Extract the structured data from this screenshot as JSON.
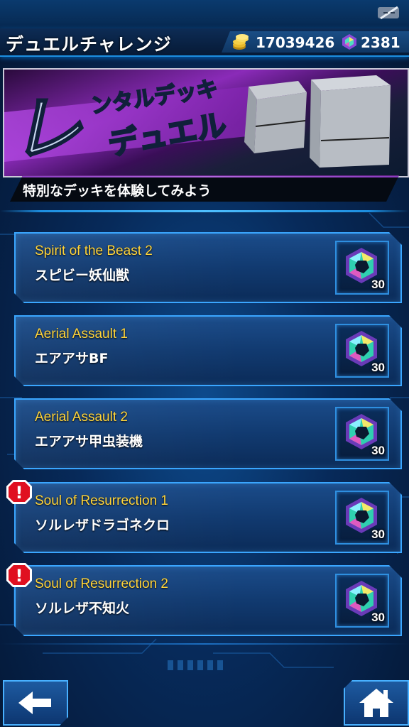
{
  "header": {
    "title": "デュエルチャレンジ",
    "gold": "17039426",
    "gems": "2381",
    "gold_icon": "gold-coins-icon",
    "gem_icon": "gem-icon"
  },
  "banner": {
    "logo_text_big": "レ",
    "logo_text_top": "ンタルデッキ",
    "logo_text_bottom": "デュエル",
    "subtitle": "特別なデッキを体験してみよう"
  },
  "decks": [
    {
      "title_en": "Spirit of the Beast 2",
      "title_jp": "スピビー妖仙獣",
      "cost": "30",
      "alert": false
    },
    {
      "title_en": "Aerial Assault 1",
      "title_jp": "エアアサBF",
      "cost": "30",
      "alert": false
    },
    {
      "title_en": "Aerial Assault 2",
      "title_jp": "エアアサ甲虫装機",
      "cost": "30",
      "alert": false
    },
    {
      "title_en": "Soul of Resurrection 1",
      "title_jp": "ソルレザドラゴネクロ",
      "cost": "30",
      "alert": true
    },
    {
      "title_en": "Soul of Resurrection 2",
      "title_jp": "ソルレザ不知火",
      "cost": "30",
      "alert": true
    }
  ],
  "alert_mark": "!",
  "colors": {
    "accent": "#3aa6ff",
    "title_yellow": "#ffd43a",
    "banner_purple": "#8a2bb8",
    "alert_red": "#e01020"
  }
}
